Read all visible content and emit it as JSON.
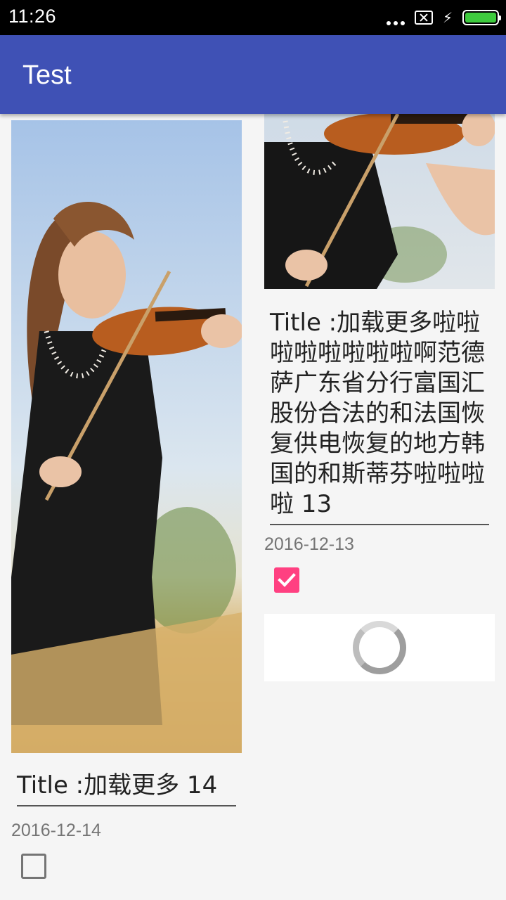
{
  "status_bar": {
    "time": "11:26",
    "icons": [
      "more-dots-icon",
      "no-sim-icon",
      "charging-bolt-icon",
      "battery-icon"
    ]
  },
  "app_bar": {
    "title": "Test",
    "color": "#3f51b5"
  },
  "cards": [
    {
      "title": "Title :加载更多 14",
      "date": "2016-12-14",
      "checked": false
    },
    {
      "title": "Title :加载更多啦啦啦啦啦啦啦啦啊范德萨广东省分行富国汇股份合法的和法国恢复供电恢复的地方韩国的和斯蒂芬啦啦啦啦 13",
      "date": "2016-12-13",
      "checked": true
    }
  ],
  "accent_color": "#ff4081"
}
